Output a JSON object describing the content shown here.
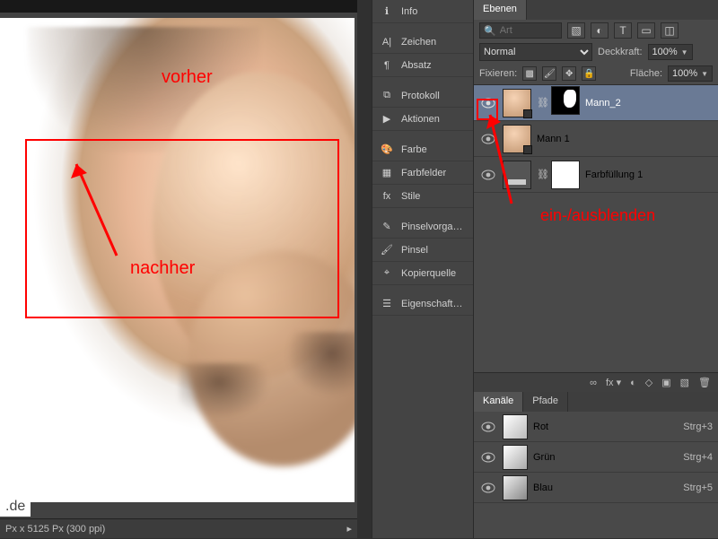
{
  "canvas": {
    "label_before": "vorher",
    "label_after": "nachher",
    "watermark": ".de"
  },
  "statusbar": {
    "text": "Px x 5125 Px (300 ppi)",
    "chevron": "▸"
  },
  "mid_panel": {
    "items": [
      {
        "icon": "info-icon",
        "label": "Info"
      },
      {
        "icon": "character-icon",
        "label": "Zeichen"
      },
      {
        "icon": "paragraph-icon",
        "label": "Absatz"
      },
      {
        "icon": "history-icon",
        "label": "Protokoll"
      },
      {
        "icon": "actions-icon",
        "label": "Aktionen"
      },
      {
        "icon": "color-icon",
        "label": "Farbe"
      },
      {
        "icon": "swatches-icon",
        "label": "Farbfelder"
      },
      {
        "icon": "styles-icon",
        "label": "Stile"
      },
      {
        "icon": "brush-presets-icon",
        "label": "Pinselvorga…"
      },
      {
        "icon": "brush-icon",
        "label": "Pinsel"
      },
      {
        "icon": "clone-source-icon",
        "label": "Kopierquelle"
      },
      {
        "icon": "properties-icon",
        "label": "Eigenschaft…"
      }
    ]
  },
  "layers_panel": {
    "tab": "Ebenen",
    "search_placeholder": "Art",
    "blend_mode": "Normal",
    "opacity_label": "Deckkraft:",
    "opacity_value": "100%",
    "lock_label": "Fixieren:",
    "fill_label": "Fläche:",
    "fill_value": "100%",
    "layers": [
      {
        "name": "Mann_2",
        "selected": true,
        "mask": "black"
      },
      {
        "name": "Mann 1",
        "selected": false,
        "mask": null
      },
      {
        "name": "Farbfüllung 1",
        "selected": false,
        "mask": "white",
        "fill": true
      }
    ],
    "annotation": "ein-/ausblenden",
    "strip_icons": [
      "∞",
      "fx ▾",
      "◐",
      "◇",
      "▣",
      "▧",
      "🗑"
    ]
  },
  "channels_panel": {
    "tabs": [
      "Kanäle",
      "Pfade"
    ],
    "active_tab": "Kanäle",
    "channels": [
      {
        "name": "Rot",
        "shortcut": "Strg+3"
      },
      {
        "name": "Grün",
        "shortcut": "Strg+4"
      },
      {
        "name": "Blau",
        "shortcut": "Strg+5"
      }
    ]
  }
}
